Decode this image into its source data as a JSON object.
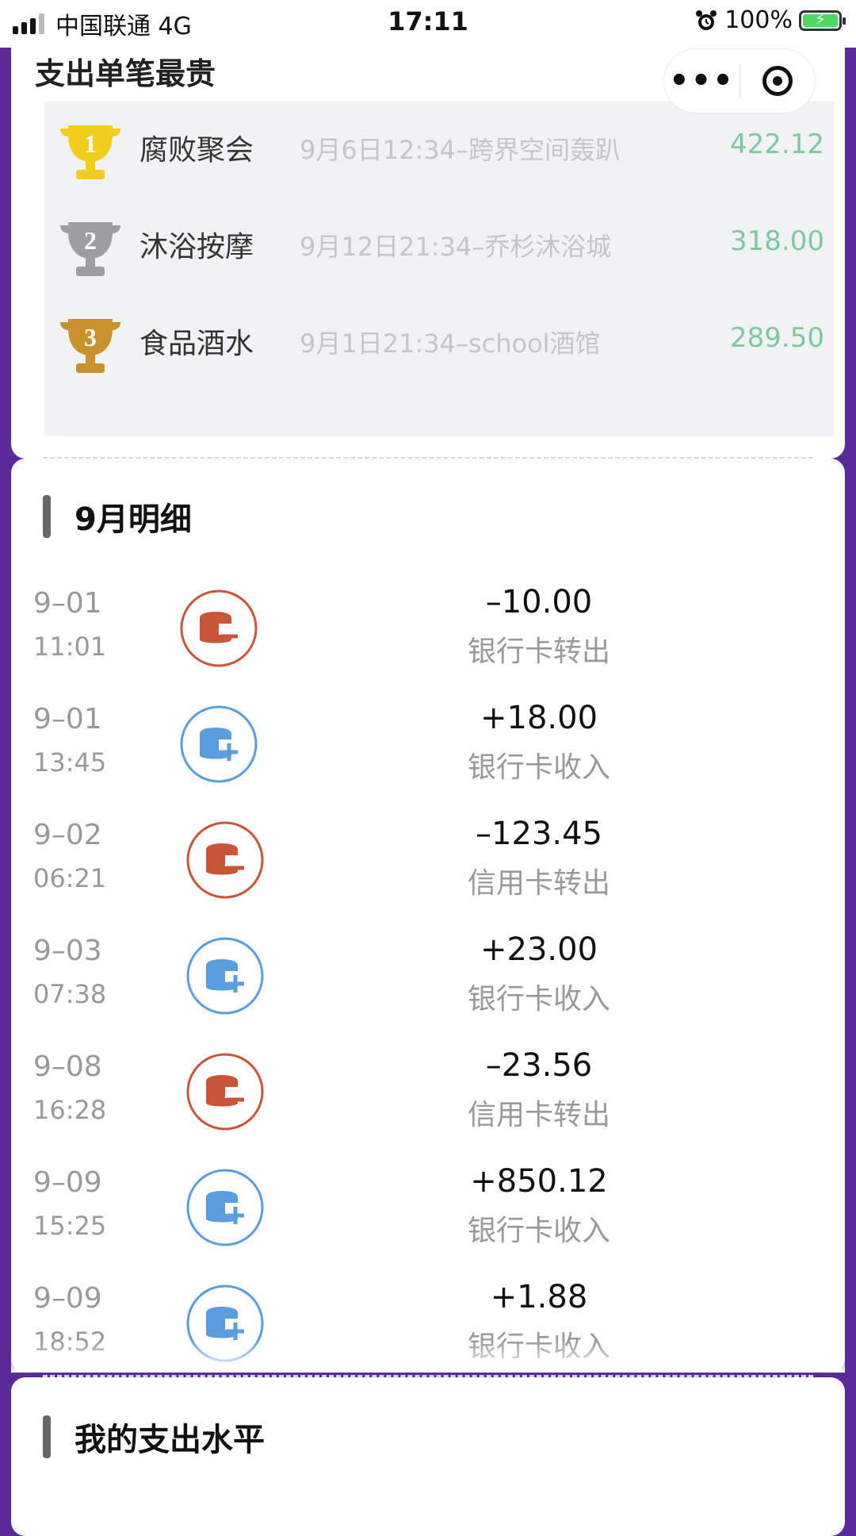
{
  "status_bar": {
    "carrier": "中国联通  4G",
    "time": "17:11",
    "battery": "100%"
  },
  "top_section": {
    "title": "支出单笔最贵",
    "ranking": [
      {
        "rank": "1",
        "category": "腐败聚会",
        "detail": "9月6日12:34–跨界空间轰趴",
        "amount": "422.12",
        "trophy_color": "#f2cd1c"
      },
      {
        "rank": "2",
        "category": "沐浴按摩",
        "detail": "9月12日21:34–乔杉沐浴城",
        "amount": "318.00",
        "trophy_color": "#9c9ea3"
      },
      {
        "rank": "3",
        "category": "食品酒水",
        "detail": "9月1日21:34–school酒馆",
        "amount": "289.50",
        "trophy_color": "#c9922c"
      }
    ]
  },
  "capsule": {
    "more_icon": "more-dots-icon",
    "close_icon": "target-icon"
  },
  "monthly": {
    "title": "9月明细",
    "transactions": [
      {
        "date": "9–01",
        "time": "11:01",
        "amount": "–10.00",
        "type": "银行卡转出",
        "direction": "out"
      },
      {
        "date": "9–01",
        "time": "13:45",
        "amount": "+18.00",
        "type": "银行卡收入",
        "direction": "in"
      },
      {
        "date": "9–02",
        "time": "06:21",
        "amount": "–123.45",
        "type": "信用卡转出",
        "direction": "out"
      },
      {
        "date": "9–03",
        "time": "07:38",
        "amount": "+23.00",
        "type": "银行卡收入",
        "direction": "in"
      },
      {
        "date": "9–08",
        "time": "16:28",
        "amount": "–23.56",
        "type": "信用卡转出",
        "direction": "out"
      },
      {
        "date": "9–09",
        "time": "15:25",
        "amount": "+850.12",
        "type": "银行卡收入",
        "direction": "in"
      },
      {
        "date": "9–09",
        "time": "18:52",
        "amount": "+1.88",
        "type": "银行卡收入",
        "direction": "in"
      }
    ]
  },
  "level": {
    "title": "我的支出水平"
  },
  "colors": {
    "out": "#c8573a",
    "in": "#5a9ee0",
    "amount_green": "#7cc89f",
    "background": "#5a2a9a"
  }
}
